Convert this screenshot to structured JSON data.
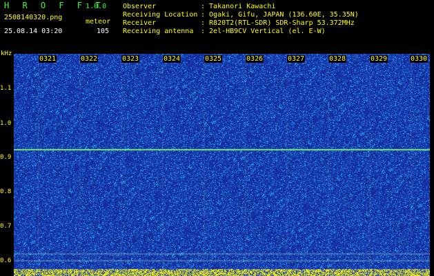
{
  "app": {
    "title": "H R O F F T",
    "version": "1.0.0"
  },
  "file": {
    "name": "2508140320.png",
    "mode": "meteor",
    "datetime": "25.08.14 03:20",
    "count": "105"
  },
  "info": [
    {
      "label": "Observer",
      "value": ": Takanori Kawachi"
    },
    {
      "label": "Receiving Location",
      "value": ": Ogaki, Gifu, JAPAN (136.60E, 35.35N)"
    },
    {
      "label": "Receiver",
      "value": ": R820T2(RTL-SDR) SDR-Sharp 53.372MHz"
    },
    {
      "label": "Receiving antenna",
      "value": ": 2el-HB9CV Vertical (el. E-W)"
    }
  ],
  "axis": {
    "unit": "kHz",
    "labels": [
      "1.1",
      "1.0",
      "0.9",
      "0.8",
      "0.7",
      "0.6"
    ],
    "time_labels": [
      "0321",
      "0322",
      "0323",
      "0324",
      "0325",
      "0326",
      "0327",
      "0328",
      "0329",
      "0330"
    ]
  },
  "colors": {
    "background": "#000000",
    "waterfall_base": "#1a2fa0",
    "noise": "#3fd0ff",
    "carrier": "#90ff90",
    "bottom_band": "#ffff00"
  }
}
